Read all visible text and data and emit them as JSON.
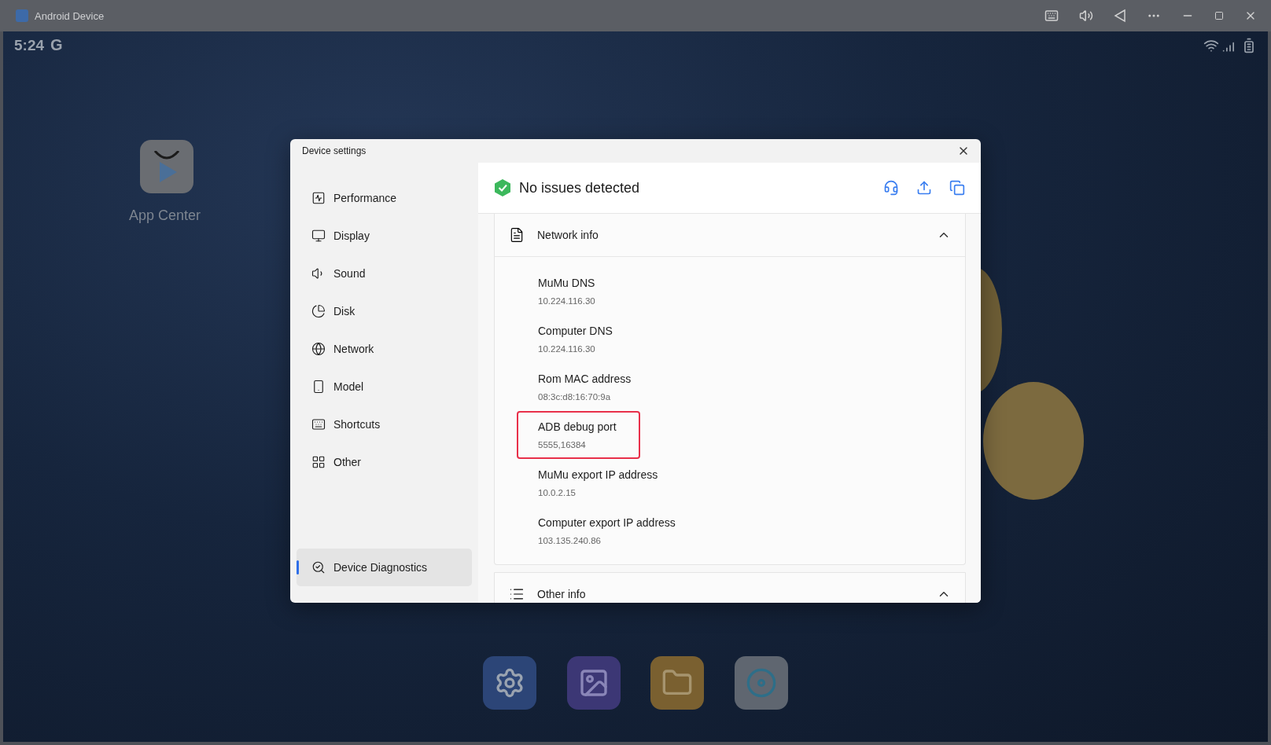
{
  "window": {
    "title": "Android Device"
  },
  "status_bar": {
    "time": "5:24",
    "logo": "G"
  },
  "desktop": {
    "apps": [
      {
        "label": "App Center"
      }
    ]
  },
  "dialog": {
    "title": "Device settings",
    "sidebar": {
      "items": [
        {
          "label": "Performance",
          "selected": false
        },
        {
          "label": "Display",
          "selected": false
        },
        {
          "label": "Sound",
          "selected": false
        },
        {
          "label": "Disk",
          "selected": false
        },
        {
          "label": "Network",
          "selected": false
        },
        {
          "label": "Model",
          "selected": false
        },
        {
          "label": "Shortcuts",
          "selected": false
        },
        {
          "label": "Other",
          "selected": false
        },
        {
          "label": "Device Diagnostics",
          "selected": true
        }
      ]
    },
    "status": {
      "text": "No issues detected"
    },
    "sections": [
      {
        "title": "Network info",
        "expanded": true,
        "items": [
          {
            "label": "MuMu DNS",
            "value": "10.224.116.30",
            "highlighted": false
          },
          {
            "label": "Computer DNS",
            "value": "10.224.116.30",
            "highlighted": false
          },
          {
            "label": "Rom MAC address",
            "value": "08:3c:d8:16:70:9a",
            "highlighted": false
          },
          {
            "label": "ADB debug port",
            "value": "5555,16384",
            "highlighted": true
          },
          {
            "label": "MuMu export IP address",
            "value": "10.0.2.15",
            "highlighted": false
          },
          {
            "label": "Computer export IP address",
            "value": "103.135.240.86",
            "highlighted": false
          }
        ]
      },
      {
        "title": "Other info",
        "expanded": true
      }
    ]
  }
}
